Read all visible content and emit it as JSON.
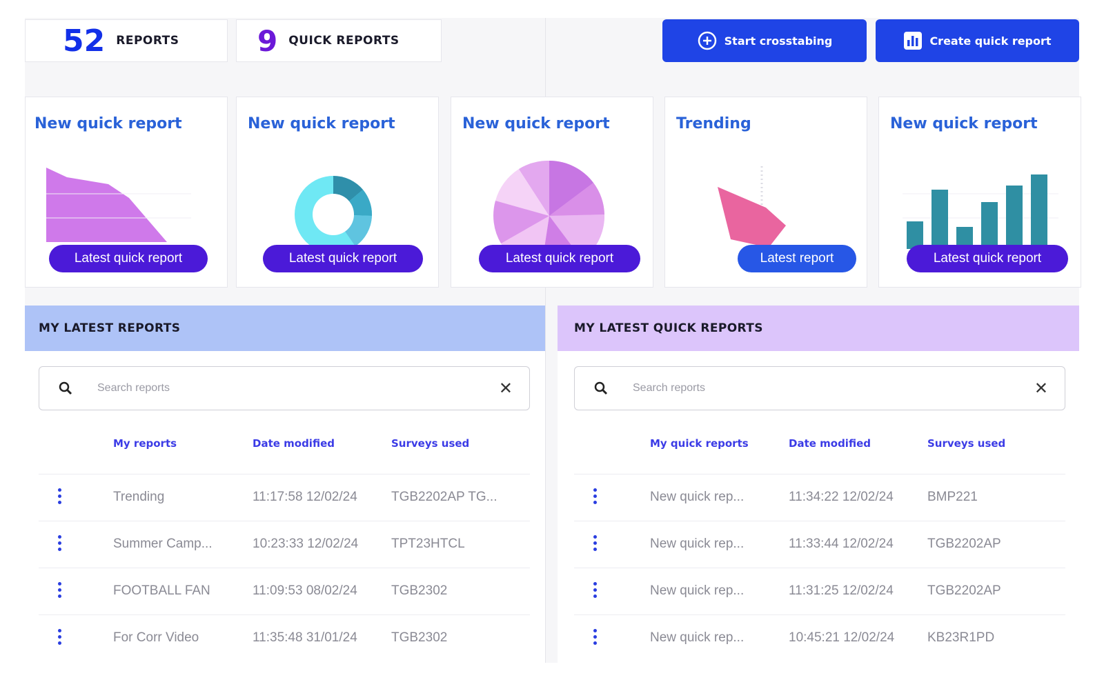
{
  "counters": {
    "reports": {
      "value": "52",
      "label": "REPORTS"
    },
    "quick_reports": {
      "value": "9",
      "label": "QUICK REPORTS"
    }
  },
  "actions": {
    "crosstab": {
      "label": "Start crosstabing",
      "icon": "plus-circle-icon"
    },
    "quick": {
      "label": "Create quick report",
      "icon": "bar-chart-icon"
    }
  },
  "cards": [
    {
      "title": "New quick report",
      "button": "Latest quick report",
      "chart_kind": "area"
    },
    {
      "title": "New quick report",
      "button": "Latest quick report",
      "chart_kind": "donut"
    },
    {
      "title": "New quick report",
      "button": "Latest quick report",
      "chart_kind": "pie"
    },
    {
      "title": "Trending",
      "button": "Latest report",
      "chart_kind": "radar"
    },
    {
      "title": "New quick report",
      "button": "Latest quick report",
      "chart_kind": "bar"
    }
  ],
  "left_section": {
    "title": "MY LATEST REPORTS",
    "search_placeholder": "Search reports",
    "columns": [
      "My reports",
      "Date modified",
      "Surveys used"
    ],
    "rows": [
      [
        "Trending",
        "11:17:58 12/02/24",
        "TGB2202AP TG..."
      ],
      [
        "Summer Camp...",
        "10:23:33 12/02/24",
        "TPT23HTCL"
      ],
      [
        "FOOTBALL FAN",
        "11:09:53 08/02/24",
        "TGB2302"
      ],
      [
        "For Corr Video",
        "11:35:48 31/01/24",
        "TGB2302"
      ]
    ]
  },
  "right_section": {
    "title": "MY LATEST QUICK REPORTS",
    "search_placeholder": "Search reports",
    "columns": [
      "My quick reports",
      "Date modified",
      "Surveys used"
    ],
    "rows": [
      [
        "New quick rep...",
        "11:34:22 12/02/24",
        "BMP221"
      ],
      [
        "New quick rep...",
        "11:33:44 12/02/24",
        "TGB2202AP"
      ],
      [
        "New quick rep...",
        "11:31:25 12/02/24",
        "TGB2202AP"
      ],
      [
        "New quick rep...",
        "10:45:21 12/02/24",
        "KB23R1PD"
      ]
    ]
  },
  "colors": {
    "primary_blue": "#1f44e6",
    "pill_purple": "#4b1ad8",
    "card_title": "#2a62d8",
    "left_header_bg": "#aec3f7",
    "right_header_bg": "#dcc5fb",
    "column_header": "#3b3be6"
  }
}
